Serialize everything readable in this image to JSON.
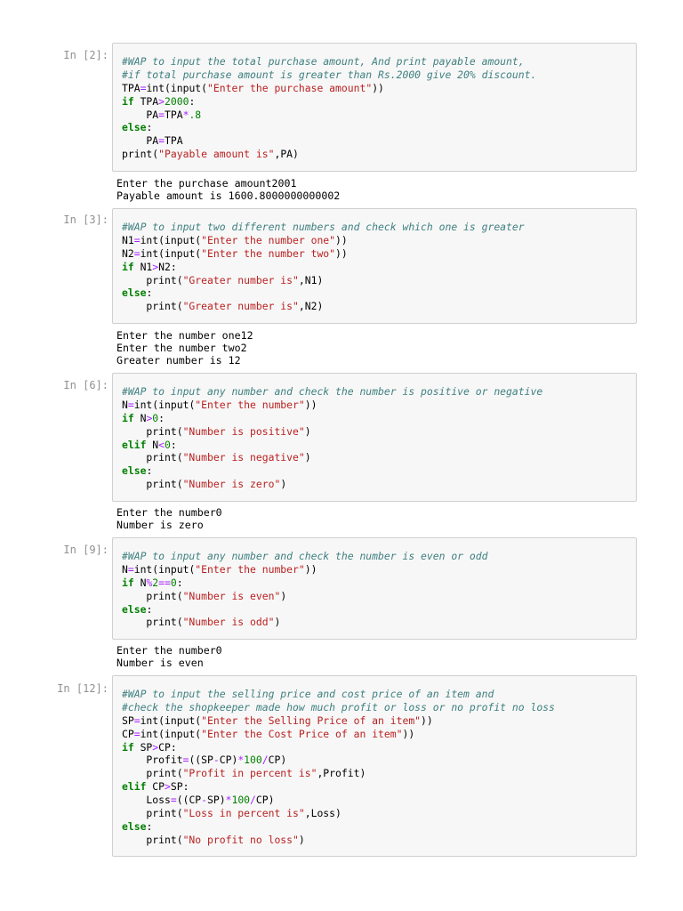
{
  "cells": [
    {
      "prompt": "In [2]:",
      "code": [
        [
          [
            "c",
            "#WAP to input the total purchase amount, And print payable amount,"
          ]
        ],
        [
          [
            "c",
            "#if total purchase amount is greater than Rs.2000 give 20% discount."
          ]
        ],
        [
          [
            "p",
            "TPA"
          ],
          [
            "o",
            "="
          ],
          [
            "p",
            "int(input("
          ],
          [
            "s",
            "\"Enter the purchase amount\""
          ],
          [
            "p",
            "))"
          ]
        ],
        [
          [
            "k",
            "if"
          ],
          [
            "p",
            " TPA"
          ],
          [
            "o",
            ">"
          ],
          [
            "n",
            "2000"
          ],
          [
            "p",
            ":"
          ]
        ],
        [
          [
            "p",
            "    PA"
          ],
          [
            "o",
            "="
          ],
          [
            "p",
            "TPA"
          ],
          [
            "o",
            "*"
          ],
          [
            "n",
            ".8"
          ]
        ],
        [
          [
            "k",
            "else"
          ],
          [
            "p",
            ":"
          ]
        ],
        [
          [
            "p",
            "    PA"
          ],
          [
            "o",
            "="
          ],
          [
            "p",
            "TPA"
          ]
        ],
        [
          [
            "p",
            "print("
          ],
          [
            "s",
            "\"Payable amount is\""
          ],
          [
            "p",
            ",PA)"
          ]
        ]
      ],
      "output": [
        "Enter the purchase amount2001",
        "Payable amount is 1600.8000000000002"
      ]
    },
    {
      "prompt": "In [3]:",
      "code": [
        [
          [
            "c",
            "#WAP to input two different numbers and check which one is greater"
          ]
        ],
        [
          [
            "p",
            "N1"
          ],
          [
            "o",
            "="
          ],
          [
            "p",
            "int(input("
          ],
          [
            "s",
            "\"Enter the number one\""
          ],
          [
            "p",
            "))"
          ]
        ],
        [
          [
            "p",
            "N2"
          ],
          [
            "o",
            "="
          ],
          [
            "p",
            "int(input("
          ],
          [
            "s",
            "\"Enter the number two\""
          ],
          [
            "p",
            "))"
          ]
        ],
        [
          [
            "k",
            "if"
          ],
          [
            "p",
            " N1"
          ],
          [
            "o",
            ">"
          ],
          [
            "p",
            "N2:"
          ]
        ],
        [
          [
            "p",
            "    print("
          ],
          [
            "s",
            "\"Greater number is\""
          ],
          [
            "p",
            ",N1)"
          ]
        ],
        [
          [
            "k",
            "else"
          ],
          [
            "p",
            ":"
          ]
        ],
        [
          [
            "p",
            "    print("
          ],
          [
            "s",
            "\"Greater number is\""
          ],
          [
            "p",
            ",N2)"
          ]
        ]
      ],
      "output": [
        "Enter the number one12",
        "Enter the number two2",
        "Greater number is 12"
      ]
    },
    {
      "prompt": "In [6]:",
      "code": [
        [
          [
            "c",
            "#WAP to input any number and check the number is positive or negative"
          ]
        ],
        [
          [
            "p",
            "N"
          ],
          [
            "o",
            "="
          ],
          [
            "p",
            "int(input("
          ],
          [
            "s",
            "\"Enter the number\""
          ],
          [
            "p",
            "))"
          ]
        ],
        [
          [
            "k",
            "if"
          ],
          [
            "p",
            " N"
          ],
          [
            "o",
            ">"
          ],
          [
            "n",
            "0"
          ],
          [
            "p",
            ":"
          ]
        ],
        [
          [
            "p",
            "    print("
          ],
          [
            "s",
            "\"Number is positive\""
          ],
          [
            "p",
            ")"
          ]
        ],
        [
          [
            "k",
            "elif"
          ],
          [
            "p",
            " N"
          ],
          [
            "o",
            "<"
          ],
          [
            "n",
            "0"
          ],
          [
            "p",
            ":"
          ]
        ],
        [
          [
            "p",
            "    print("
          ],
          [
            "s",
            "\"Number is negative\""
          ],
          [
            "p",
            ")"
          ]
        ],
        [
          [
            "k",
            "else"
          ],
          [
            "p",
            ":"
          ]
        ],
        [
          [
            "p",
            "    print("
          ],
          [
            "s",
            "\"Number is zero\""
          ],
          [
            "p",
            ")"
          ]
        ]
      ],
      "output": [
        "Enter the number0",
        "Number is zero"
      ]
    },
    {
      "prompt": "In [9]:",
      "code": [
        [
          [
            "c",
            "#WAP to input any number and check the number is even or odd"
          ]
        ],
        [
          [
            "p",
            "N"
          ],
          [
            "o",
            "="
          ],
          [
            "p",
            "int(input("
          ],
          [
            "s",
            "\"Enter the number\""
          ],
          [
            "p",
            "))"
          ]
        ],
        [
          [
            "k",
            "if"
          ],
          [
            "p",
            " N"
          ],
          [
            "o",
            "%"
          ],
          [
            "n",
            "2"
          ],
          [
            "o",
            "=="
          ],
          [
            "n",
            "0"
          ],
          [
            "p",
            ":"
          ]
        ],
        [
          [
            "p",
            "    print("
          ],
          [
            "s",
            "\"Number is even\""
          ],
          [
            "p",
            ")"
          ]
        ],
        [
          [
            "k",
            "else"
          ],
          [
            "p",
            ":"
          ]
        ],
        [
          [
            "p",
            "    print("
          ],
          [
            "s",
            "\"Number is odd\""
          ],
          [
            "p",
            ")"
          ]
        ]
      ],
      "output": [
        "Enter the number0",
        "Number is even"
      ]
    },
    {
      "prompt": "In [12]:",
      "code": [
        [
          [
            "c",
            "#WAP to input the selling price and cost price of an item and"
          ]
        ],
        [
          [
            "c",
            "#check the shopkeeper made how much profit or loss or no profit no loss"
          ]
        ],
        [
          [
            "p",
            "SP"
          ],
          [
            "o",
            "="
          ],
          [
            "p",
            "int(input("
          ],
          [
            "s",
            "\"Enter the Selling Price of an item\""
          ],
          [
            "p",
            "))"
          ]
        ],
        [
          [
            "p",
            "CP"
          ],
          [
            "o",
            "="
          ],
          [
            "p",
            "int(input("
          ],
          [
            "s",
            "\"Enter the Cost Price of an item\""
          ],
          [
            "p",
            "))"
          ]
        ],
        [
          [
            "k",
            "if"
          ],
          [
            "p",
            " SP"
          ],
          [
            "o",
            ">"
          ],
          [
            "p",
            "CP:"
          ]
        ],
        [
          [
            "p",
            "    Profit"
          ],
          [
            "o",
            "="
          ],
          [
            "p",
            "((SP"
          ],
          [
            "o",
            "-"
          ],
          [
            "p",
            "CP)"
          ],
          [
            "o",
            "*"
          ],
          [
            "n",
            "100"
          ],
          [
            "o",
            "/"
          ],
          [
            "p",
            "CP)"
          ]
        ],
        [
          [
            "p",
            "    print("
          ],
          [
            "s",
            "\"Profit in percent is\""
          ],
          [
            "p",
            ",Profit)"
          ]
        ],
        [
          [
            "k",
            "elif"
          ],
          [
            "p",
            " CP"
          ],
          [
            "o",
            ">"
          ],
          [
            "p",
            "SP:"
          ]
        ],
        [
          [
            "p",
            "    Loss"
          ],
          [
            "o",
            "="
          ],
          [
            "p",
            "((CP"
          ],
          [
            "o",
            "-"
          ],
          [
            "p",
            "SP)"
          ],
          [
            "o",
            "*"
          ],
          [
            "n",
            "100"
          ],
          [
            "o",
            "/"
          ],
          [
            "p",
            "CP)"
          ]
        ],
        [
          [
            "p",
            "    print("
          ],
          [
            "s",
            "\"Loss in percent is\""
          ],
          [
            "p",
            ",Loss)"
          ]
        ],
        [
          [
            "k",
            "else"
          ],
          [
            "p",
            ":"
          ]
        ],
        [
          [
            "p",
            "    print("
          ],
          [
            "s",
            "\"No profit no loss\""
          ],
          [
            "p",
            ")"
          ]
        ]
      ],
      "output": []
    }
  ]
}
